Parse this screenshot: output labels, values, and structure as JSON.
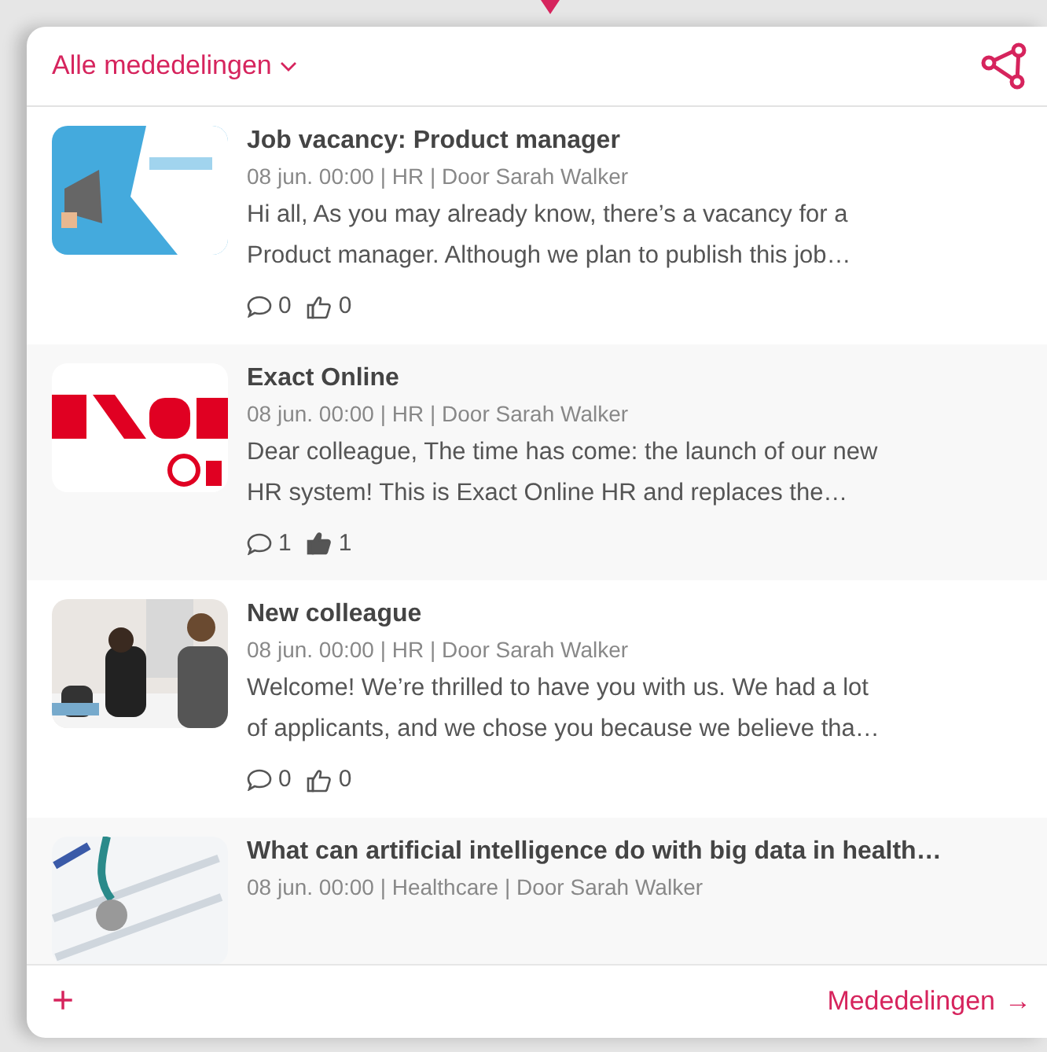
{
  "header": {
    "filter": "Alle mededelingen"
  },
  "announcements": [
    {
      "kind": "picture",
      "title": "Job vacancy: Product manager",
      "meta": "08 jun. 00:00 | HR | Door Sarah Walker",
      "body_lines": [
        "Hi all, As you may already know, there’s a vacancy for a",
        "Product manager. Although we plan to publish this job…"
      ],
      "comments": "0",
      "likes": "0",
      "liked": false
    },
    {
      "kind": "picture",
      "title": "Exact Online",
      "meta": "08 jun. 00:00 | HR | Door Sarah Walker",
      "body_lines": [
        "Dear colleague, The time has come: the launch of our new",
        "HR system! This is Exact Online HR and replaces the…"
      ],
      "comments": "1",
      "likes": "1",
      "liked": true
    },
    {
      "kind": "picture",
      "title": "New colleague",
      "meta": "08 jun. 00:00 | HR | Door Sarah Walker",
      "body_lines": [
        "Welcome! We’re thrilled to have you with us. We had a lot",
        "of applicants, and we chose you because we believe tha…"
      ],
      "comments": "0",
      "likes": "0",
      "liked": false
    },
    {
      "kind": "picture",
      "title": "What can artificial intelligence do with big data in health…",
      "meta": "08 jun. 00:00 | Healthcare | Door Sarah Walker"
    }
  ],
  "footer": {
    "add": "+",
    "link": "Mededelingen",
    "arrow": "→"
  }
}
